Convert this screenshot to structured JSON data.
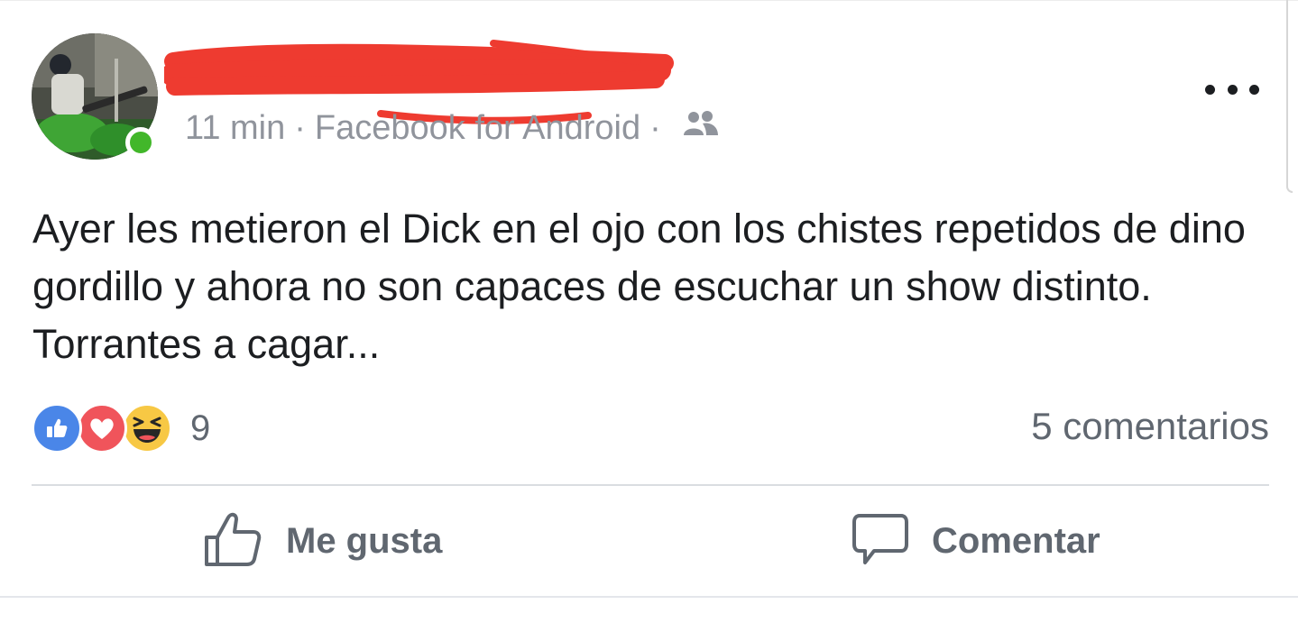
{
  "post": {
    "author_name": "",
    "timestamp": "11 min",
    "separator": "·",
    "source": "Facebook for Android",
    "audience_icon": "friends-icon",
    "more_icon": "more-horizontal-icon",
    "text": "Ayer les metieron el Dick en el ojo con los chistes repetidos de dino gordillo y ahora no son capaces de escuchar un show distinto. Torrantes a cagar...",
    "online": true
  },
  "reactions": {
    "types": [
      "like-reaction-icon",
      "love-reaction-icon",
      "haha-reaction-icon"
    ],
    "count": "9"
  },
  "comments": {
    "count_label": "5 comentarios"
  },
  "actions": {
    "like_label": "Me gusta",
    "comment_label": "Comentar"
  },
  "colors": {
    "like_blue": "#4a86e8",
    "love_red": "#f0545b",
    "haha_yellow": "#f7c844",
    "online_green": "#42b72a",
    "redaction_red": "#ee3b30",
    "meta_gray": "#90949c"
  }
}
